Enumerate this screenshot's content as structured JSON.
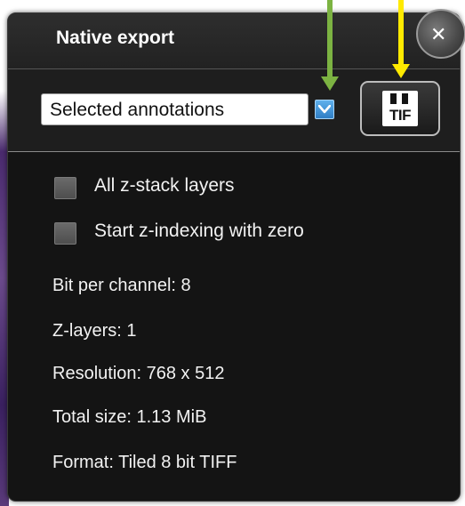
{
  "dialog": {
    "title": "Native export",
    "close_glyph": "✕",
    "close_icon": "close-icon"
  },
  "toolbar": {
    "selected_option": "Selected annotations",
    "dropdown_icon": "chevron-down-icon",
    "export_button": {
      "icon": "floppy-disk-icon",
      "label": "TIF"
    }
  },
  "options": [
    {
      "label": "All z-stack layers",
      "checked": false
    },
    {
      "label": "Start z-indexing with zero",
      "checked": false
    }
  ],
  "info": {
    "bit_per_channel": "Bit per channel: 8",
    "z_layers": "Z-layers: 1",
    "resolution": "Resolution: 768 x 512",
    "total_size": "Total size: 1.13 MiB",
    "format": "Format: Tiled 8 bit TIFF"
  },
  "annotations": {
    "arrow_colors": [
      "#7cb342",
      "#ffea00"
    ]
  },
  "colors": {
    "dialog_background": "#141414",
    "accent_blue": "#2f7ec5",
    "text": "#f2f2f2"
  }
}
